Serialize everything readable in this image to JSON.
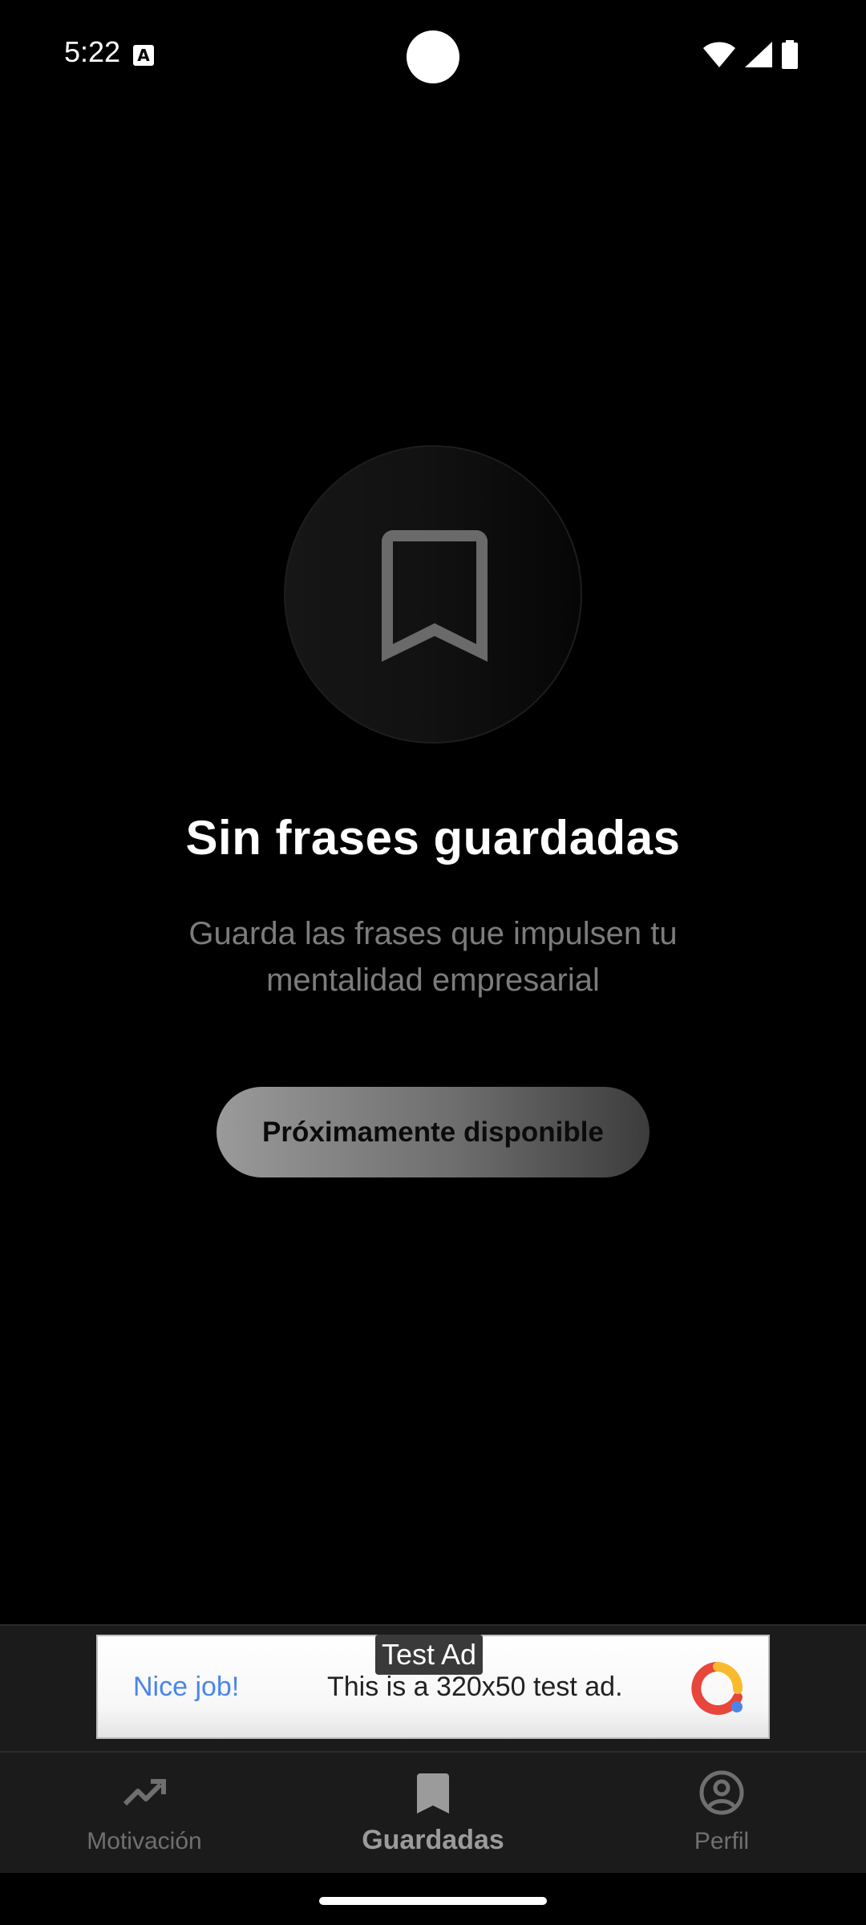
{
  "status_bar": {
    "time": "5:22",
    "notification_icon": "a-icon",
    "icons": [
      "wifi-icon",
      "signal-icon",
      "battery-icon"
    ]
  },
  "empty_state": {
    "icon": "bookmark-icon",
    "title": "Sin frases guardadas",
    "subtitle": "Guarda las frases que impulsen tu mentalidad empresarial",
    "button_label": "Próximamente disponible"
  },
  "ad": {
    "label": "Test Ad",
    "headline": "Nice job!",
    "body": "This is a 320x50 test ad.",
    "logo_icon": "admob-logo-icon"
  },
  "bottom_nav": {
    "items": [
      {
        "label": "Motivación",
        "icon": "trending-up-icon",
        "active": false
      },
      {
        "label": "Guardadas",
        "icon": "bookmark-icon",
        "active": true
      },
      {
        "label": "Perfil",
        "icon": "account-circle-icon",
        "active": false
      }
    ]
  },
  "colors": {
    "background": "#000000",
    "nav_background": "#1b1b1b",
    "subtitle": "#7c7c7c",
    "inactive_nav": "#707070",
    "ad_headline": "#4a86e8"
  }
}
